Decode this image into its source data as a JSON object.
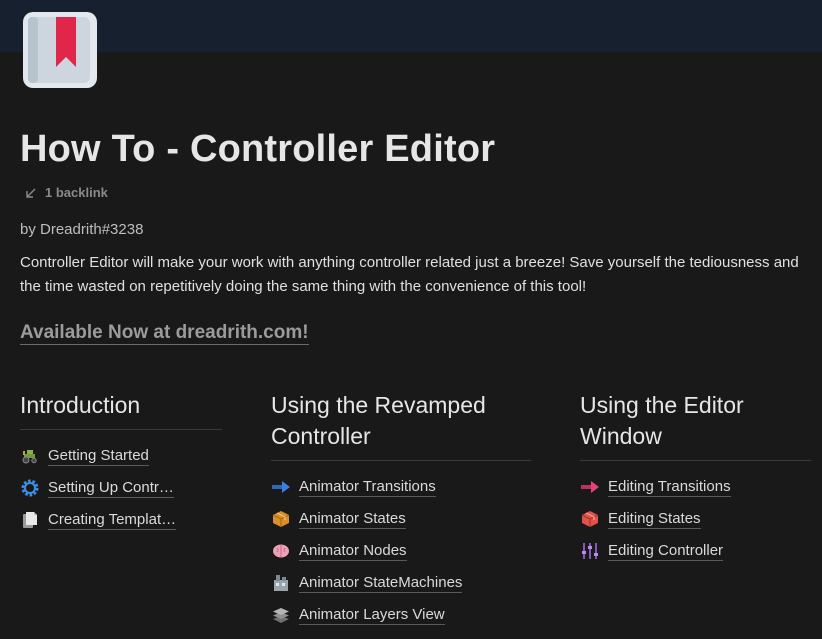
{
  "page": {
    "title": "How To - Controller Editor",
    "backlink_label": "1 backlink",
    "author": "by Dreadrith#3238",
    "description": "Controller Editor will make your work with anything controller related just a breeze! Save yourself the tediousness and the time wasted on repetitively doing the same thing with the convenience of this tool!",
    "cta_label": "Available Now at dreadrith.com!",
    "icon": "bookmark-book-icon"
  },
  "columns": [
    {
      "heading": "Introduction",
      "items": [
        {
          "icon": "tractor-icon",
          "label": "Getting Started"
        },
        {
          "icon": "gear-icon",
          "label": "Setting Up Contr…"
        },
        {
          "icon": "page-icon",
          "label": "Creating Templat…"
        }
      ]
    },
    {
      "heading": "Using the Revamped Controller",
      "items": [
        {
          "icon": "blue-arrow-icon",
          "label": "Animator Transitions"
        },
        {
          "icon": "box-icon",
          "label": "Animator States"
        },
        {
          "icon": "brain-icon",
          "label": "Animator Nodes"
        },
        {
          "icon": "factory-icon",
          "label": "Animator StateMachines"
        },
        {
          "icon": "layers-icon",
          "label": "Animator Layers View"
        }
      ]
    },
    {
      "heading": "Using the Editor Window",
      "items": [
        {
          "icon": "pink-arrow-icon",
          "label": "Editing Transitions"
        },
        {
          "icon": "red-box-icon",
          "label": "Editing States"
        },
        {
          "icon": "sliders-icon",
          "label": "Editing Controller"
        }
      ]
    }
  ],
  "colors": {
    "background": "#191919",
    "cover": "#17202e",
    "text": "#d4d4d4",
    "muted": "#8a8a8a"
  }
}
